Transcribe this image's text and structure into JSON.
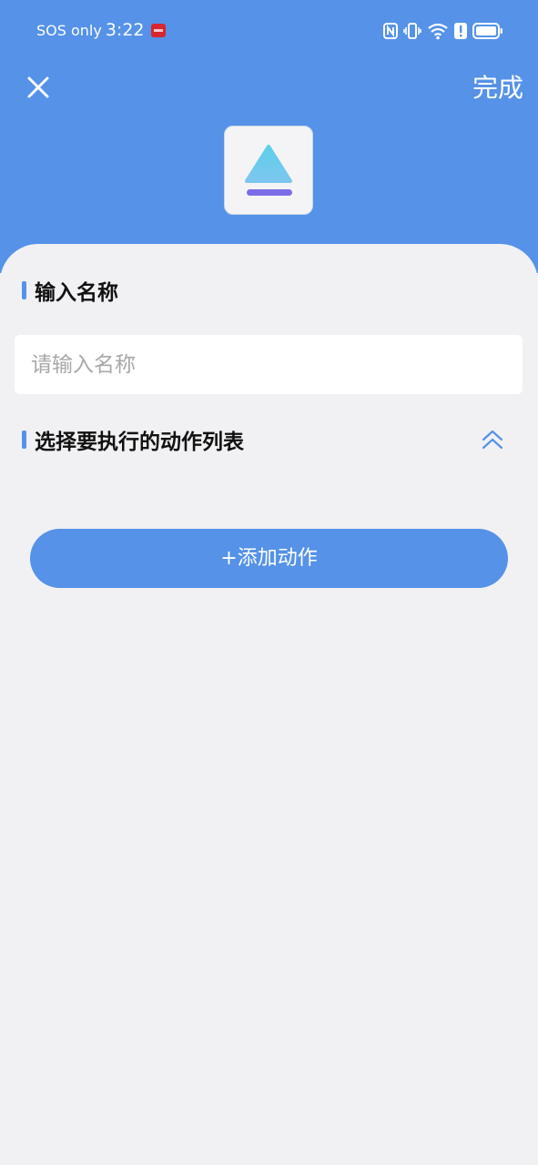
{
  "status_bar": {
    "carrier": "SOS only",
    "time": "3:22",
    "icons": [
      "notification-icon",
      "nfc-icon",
      "vibrate-icon",
      "wifi-icon",
      "alert-icon",
      "battery-icon"
    ]
  },
  "header": {
    "close_icon": "close-icon",
    "done_label": "完成",
    "app_icon": "eject-triangle-icon",
    "background_color": "#5592e8"
  },
  "form": {
    "name_section_title": "输入名称",
    "name_input": {
      "placeholder": "请输入名称",
      "value": ""
    },
    "actions_section_title": "选择要执行的动作列表",
    "collapse_icon": "double-chevron-up-icon",
    "add_action_label": "+添加动作"
  },
  "colors": {
    "accent": "#5592e8",
    "background": "#f1f1f4",
    "icon_gradient_top": "#5dd0ea",
    "icon_gradient_bottom": "#7cc6ef",
    "icon_bar": "#7b6de8"
  }
}
